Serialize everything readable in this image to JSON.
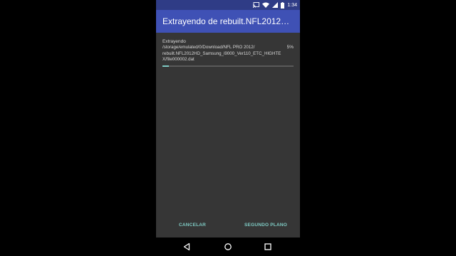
{
  "status_bar": {
    "time": "1:34",
    "icons": [
      "cast-icon",
      "wifi-icon",
      "signal-icon",
      "battery-icon"
    ]
  },
  "dialog": {
    "title": "Extrayendo de rebuilt.NFL2012HD...",
    "label": "Extrayendo",
    "path": "/storage/emulated/0/Download/NFL PRO 2012/\nrebuilt.NFL2012HD_Samsung_i9000_Ver110_ETC_HIGHTEX/file000002.dat",
    "percent_text": "5%",
    "progress": 0.05,
    "cancel_label": "CANCELAR",
    "background_label": "SEGUNDO PLANO"
  },
  "colors": {
    "status_bar": "#2f3c86",
    "app_bar": "#3f51b5",
    "dialog_bg": "#363636",
    "accent": "#7fcbc4"
  },
  "nav_bar": {
    "icons": [
      "back-icon",
      "home-icon",
      "recents-icon"
    ]
  }
}
